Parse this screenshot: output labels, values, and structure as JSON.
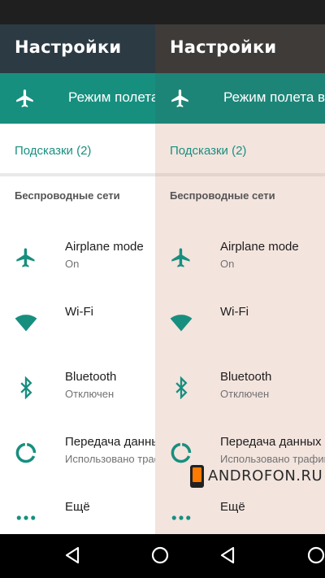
{
  "colors": {
    "teal": "#178f7f",
    "toolbar_dark": "#2c3a44",
    "toolbar_warm": "#3f3b39",
    "content_left": "#ffffff",
    "content_right": "#f3e4de"
  },
  "header": {
    "title": "Настройки"
  },
  "airplane_bar": {
    "label": "Режим полета в"
  },
  "hints": {
    "label": "Подсказки (2)"
  },
  "section": {
    "label": "Беспроводные сети"
  },
  "items": [
    {
      "title": "Airplane mode",
      "subtitle": "On",
      "icon": "airplane-icon"
    },
    {
      "title": "Wi-Fi",
      "subtitle": "",
      "icon": "wifi-icon"
    },
    {
      "title": "Bluetooth",
      "subtitle": "Отключен",
      "icon": "bluetooth-icon"
    },
    {
      "title": "Передача данных",
      "subtitle": "Использовано трафика",
      "icon": "data-usage-icon"
    },
    {
      "title": "Ещё",
      "subtitle": "",
      "icon": "more-icon"
    }
  ],
  "nav": {
    "buttons": [
      "back-icon",
      "home-icon"
    ]
  },
  "watermark": {
    "text": "ANDROFON.RU"
  }
}
